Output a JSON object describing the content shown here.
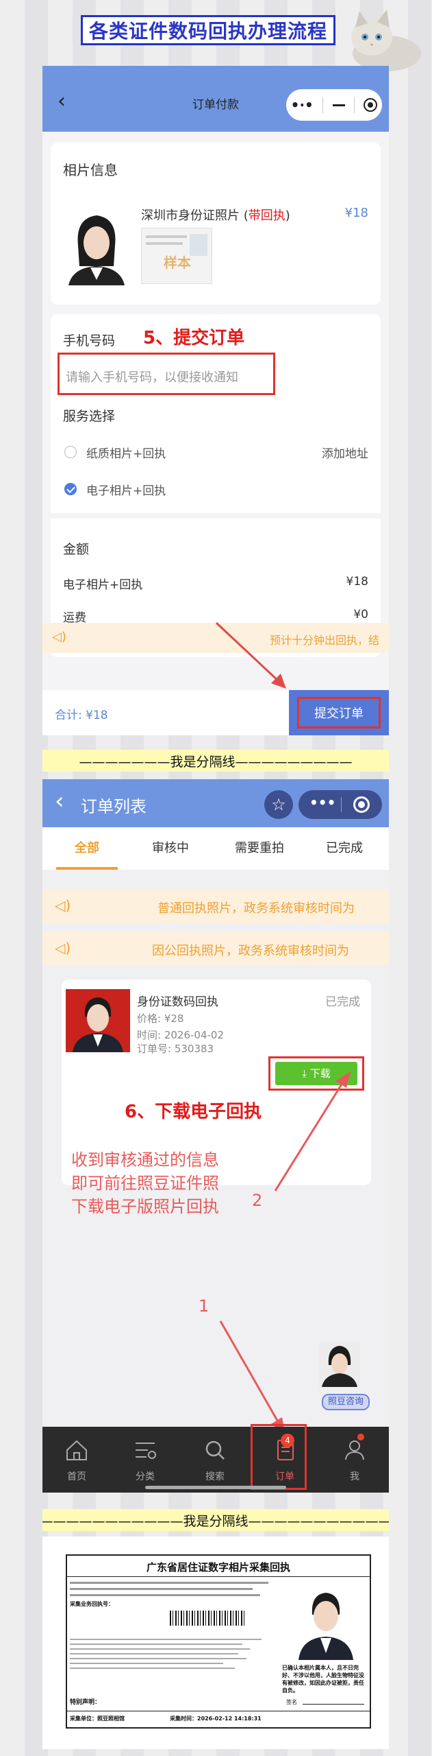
{
  "banner_title": "各类证件数码回执办理流程",
  "divider_text": "———————我是分隔线—————————",
  "divider_text_2": "———————————我是分隔线———————————",
  "step5": {
    "nav_title": "订单付款",
    "photo_section_title": "相片信息",
    "product_name": "深圳市身份证照片 (",
    "product_name_red": "带回执",
    "product_name_end": ")",
    "product_price": "¥18",
    "watermark": "样本",
    "phone_label": "手机号码",
    "callout": "5、提交订单",
    "phone_placeholder": "请输入手机号码，以便接收通知",
    "service_title": "服务选择",
    "option1": "纸质相片+回执",
    "add_address": "添加地址",
    "option2": "电子相片+回执",
    "amount_title": "金额",
    "amount_item": "电子相片+回执",
    "amount_item_value": "¥18",
    "shipping": "运费",
    "shipping_value": "¥0",
    "notice": "预计十分钟出回执，结",
    "total": "合计: ¥18",
    "submit": "提交订单"
  },
  "step6": {
    "nav_title": "订单列表",
    "tabs": [
      "全部",
      "审核中",
      "需要重拍",
      "已完成"
    ],
    "notice1": "普通回执照片，政务系统审核时间为",
    "notice2": "因公回执照片，政务系统审核时间为",
    "order_title": "身份证数码回执",
    "order_status": "已完成",
    "order_price": "价格: ¥28",
    "order_time": "时间: 2026-04-02",
    "order_no": "订单号: 530383",
    "download": "下载",
    "callout": "6、下载电子回执",
    "explain": [
      "收到审核通过的信息",
      "即可前往照豆证件照",
      "下载电子版照片回执"
    ],
    "num1": "1",
    "num2": "2",
    "consult": "照豆咨询",
    "badge": "4",
    "tabbar": [
      "首页",
      "分类",
      "搜索",
      "订单",
      "我"
    ]
  },
  "receipt": {
    "title": "广东省居住证数字相片采集回执",
    "header_line": "采集业务回执号：",
    "side_note": "已确认本相片属本人，且不日完好、不涉以他用，人脸生物特征没有被修改，如因此办证被拒，责任自负。",
    "special": "特别声明：",
    "collect_unit": "采集单位：照豆照相馆",
    "collect_time": "采集时间：2026-02-12 14:18:31",
    "sign": "签名"
  },
  "colors": {
    "nav_blue": "#6f95e0",
    "accent_red": "#e21b1b",
    "download_green": "#5cc12f",
    "tab_orange": "#f0a030"
  }
}
